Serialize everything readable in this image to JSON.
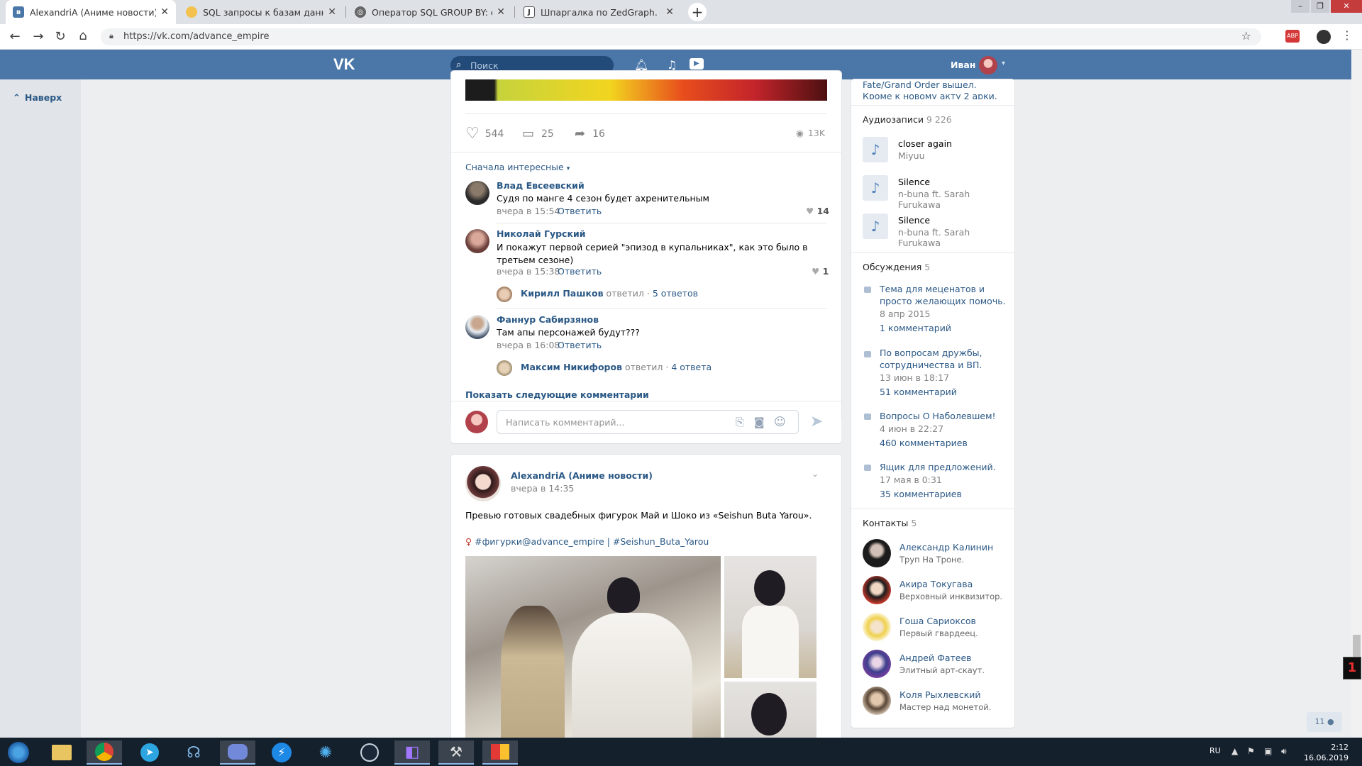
{
  "browser": {
    "tabs": [
      {
        "title": "AlexandriA (Аниме новости)"
      },
      {
        "title": "SQL запросы к базам данных за"
      },
      {
        "title": "Оператор SQL GROUP BY: синта"
      },
      {
        "title": "Шпаргалка по ZedGraph. Как на"
      }
    ],
    "url": "https://vk.com/advance_empire"
  },
  "vk": {
    "logo": "VK",
    "search_placeholder": "Поиск",
    "user_name": "Иван",
    "back_to_top": "Наверх"
  },
  "post1": {
    "likes": "544",
    "comments_count": "25",
    "shares": "16",
    "views": "13K",
    "sort_label": "Сначала интересные",
    "comments": [
      {
        "author": "Влад Евсеевский",
        "text": "Судя по манге 4 сезон будет ахренительным",
        "time": "вчера в 15:54",
        "reply": "Ответить",
        "likes": "14"
      },
      {
        "author": "Николай Гурский",
        "text": "И покажут первой серией \"эпизод в купальниках\", как это было в третьем сезоне)",
        "time": "вчера в 15:38",
        "reply": "Ответить",
        "likes": "1",
        "thread_author": "Кирилл Пашков",
        "thread_action": "ответил",
        "thread_count": "5 ответов"
      },
      {
        "author": "Фаннур Сабирзянов",
        "text": "Там апы персонажей будут???",
        "time": "вчера в 16:08",
        "reply": "Ответить",
        "thread_author": "Максим Никифоров",
        "thread_action": "ответил",
        "thread_count": "4 ответа"
      }
    ],
    "show_next": "Показать следующие комментарии",
    "comment_placeholder": "Написать комментарий..."
  },
  "post2": {
    "group": "AlexandriA (Аниме новости)",
    "time": "вчера в 14:35",
    "text": "Превью готовых свадебных фигурок Май и Шоко из «Seishun Buta Yarou».",
    "tags": "#фигурки@advance_empire | #Seishun_Buta_Yarou"
  },
  "right": {
    "top_text": "Fate/Grand Order вышел. Кроме к новому акту 2 арки.",
    "audio_title": "Аудиозаписи",
    "audio_count": "9 226",
    "audios": [
      {
        "title": "closer again",
        "artist": "Miyuu"
      },
      {
        "title": "Silence",
        "artist": "n-buna ft. Sarah Furukawa"
      },
      {
        "title": "Silence",
        "artist": "n-buna ft. Sarah Furukawa"
      }
    ],
    "disc_title": "Обсуждения",
    "disc_count": "5",
    "discussions": [
      {
        "title": "Тема для меценатов и просто желающих помочь.",
        "date": "8 апр 2015",
        "comments": "1 комментарий"
      },
      {
        "title": "По вопросам дружбы, сотрудничества и ВП.",
        "date": "13 июн в 18:17",
        "comments": "51 комментарий"
      },
      {
        "title": "Вопросы О Наболевшем!",
        "date": "4 июн в 22:27",
        "comments": "460 комментариев"
      },
      {
        "title": "Ящик для предложений.",
        "date": "17 мая в 0:31",
        "comments": "35 комментариев"
      }
    ],
    "contacts_title": "Контакты",
    "contacts_count": "5",
    "contacts": [
      {
        "name": "Александр Калинин",
        "role": "Труп На Троне."
      },
      {
        "name": "Акира Токугава",
        "role": "Верховный инквизитор."
      },
      {
        "name": "Гоша Сариоксов",
        "role": "Первый гвардеец."
      },
      {
        "name": "Андрей Фатеев",
        "role": "Элитный арт-скаут."
      },
      {
        "name": "Коля Рыхлевский",
        "role": "Мастер над монетой."
      }
    ],
    "online_count": "11"
  },
  "taskbar": {
    "lang": "RU",
    "time": "2:12",
    "date": "16.06.2019"
  },
  "colors": {
    "vk_blue": "#4a76a8",
    "link": "#2a5885",
    "taskbar": "#15202d"
  }
}
